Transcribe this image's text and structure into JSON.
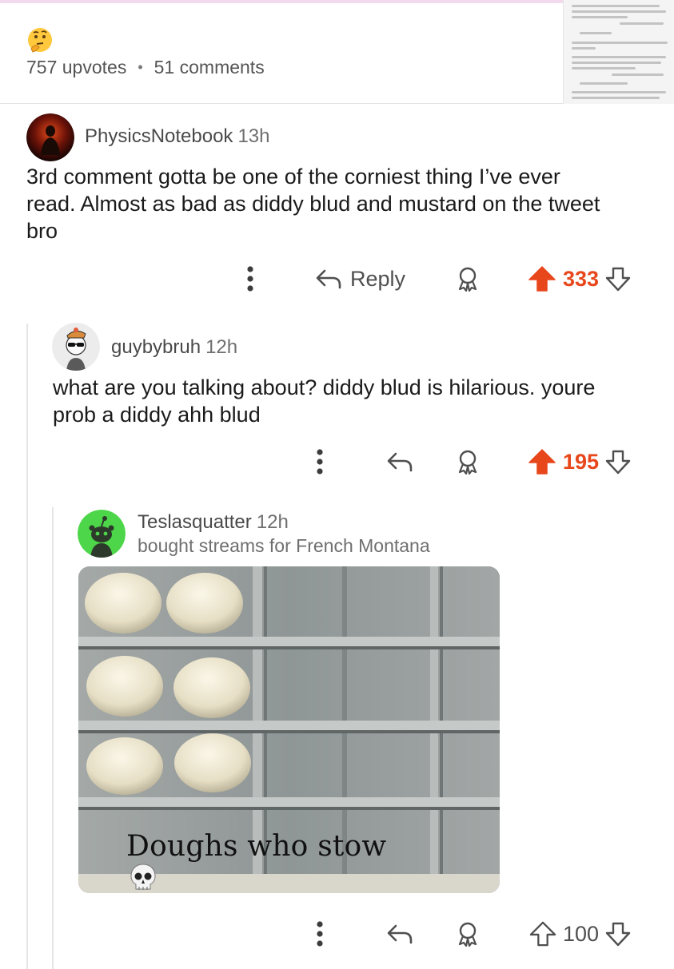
{
  "post": {
    "upvotes": "757 upvotes",
    "separator": "•",
    "comments": "51 comments",
    "emoji_icon": "thinking-face-icon"
  },
  "comments": [
    {
      "username": "PhysicsNotebook",
      "time": "13h",
      "body_line1": "3rd comment gotta be one of the corniest thing I’ve ever",
      "body_line2": "read. Almost as bad as diddy blud and mustard on the tweet",
      "body_line3": "bro",
      "reply_label": "Reply",
      "score": "333"
    },
    {
      "username": "guybybruh",
      "time": "12h",
      "body_line1": "what are you talking about? diddy blud is hilarious. youre",
      "body_line2": "prob a diddy ahh blud",
      "score": "195"
    },
    {
      "username": "Teslasquatter",
      "time": "12h",
      "flair": "bought streams for French Montana",
      "image_caption": "Doughs who stow",
      "score": "100"
    }
  ],
  "colors": {
    "upvote_active": "#e8471c",
    "text_primary": "#1a1a1b",
    "text_meta": "#6f6f6f",
    "thread_line": "#e6e6e6"
  },
  "icons": [
    "more-options-icon",
    "reply-arrow-icon",
    "award-icon",
    "upvote-icon",
    "downvote-icon",
    "skull-icon"
  ]
}
